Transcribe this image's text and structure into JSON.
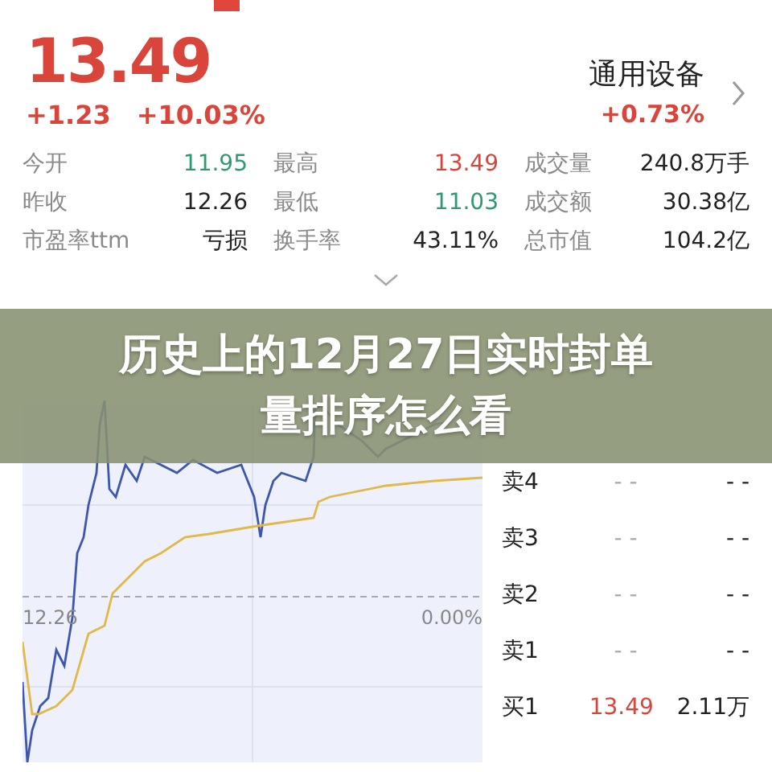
{
  "quote": {
    "price": "13.49",
    "change": "+1.23",
    "change_pct": "+10.03%",
    "color": "#d9453b"
  },
  "sector": {
    "name": "通用设备",
    "change_pct": "+0.73%",
    "color": "#d9453b"
  },
  "stats": [
    {
      "label": "今开",
      "value": "11.95",
      "color": "#2f9a70"
    },
    {
      "label": "最高",
      "value": "13.49",
      "color": "#d9453b"
    },
    {
      "label": "成交量",
      "value": "240.8万手",
      "color": "#222222"
    },
    {
      "label": "昨收",
      "value": "12.26",
      "color": "#222222"
    },
    {
      "label": "最低",
      "value": "11.03",
      "color": "#2f9a70"
    },
    {
      "label": "成交额",
      "value": "30.38亿",
      "color": "#222222"
    },
    {
      "label": "市盈率ttm",
      "value": "亏损",
      "color": "#222222"
    },
    {
      "label": "换手率",
      "value": "43.11%",
      "color": "#222222"
    },
    {
      "label": "总市值",
      "value": "104.2亿",
      "color": "#222222"
    }
  ],
  "chart": {
    "base_label": "12.26",
    "base_pct": "0.00%"
  },
  "order_book": [
    {
      "label": "卖4",
      "price": "- -",
      "volume": "- -",
      "color": "#aaaaaa"
    },
    {
      "label": "卖3",
      "price": "- -",
      "volume": "- -",
      "color": "#aaaaaa"
    },
    {
      "label": "卖2",
      "price": "- -",
      "volume": "- -",
      "color": "#aaaaaa"
    },
    {
      "label": "卖1",
      "price": "- -",
      "volume": "- -",
      "color": "#aaaaaa"
    },
    {
      "label": "买1",
      "price": "13.49",
      "volume": "2.11万",
      "color": "#d9453b"
    }
  ],
  "banner": {
    "title": "历史上的12月27日实时封单量排序怎么看"
  }
}
